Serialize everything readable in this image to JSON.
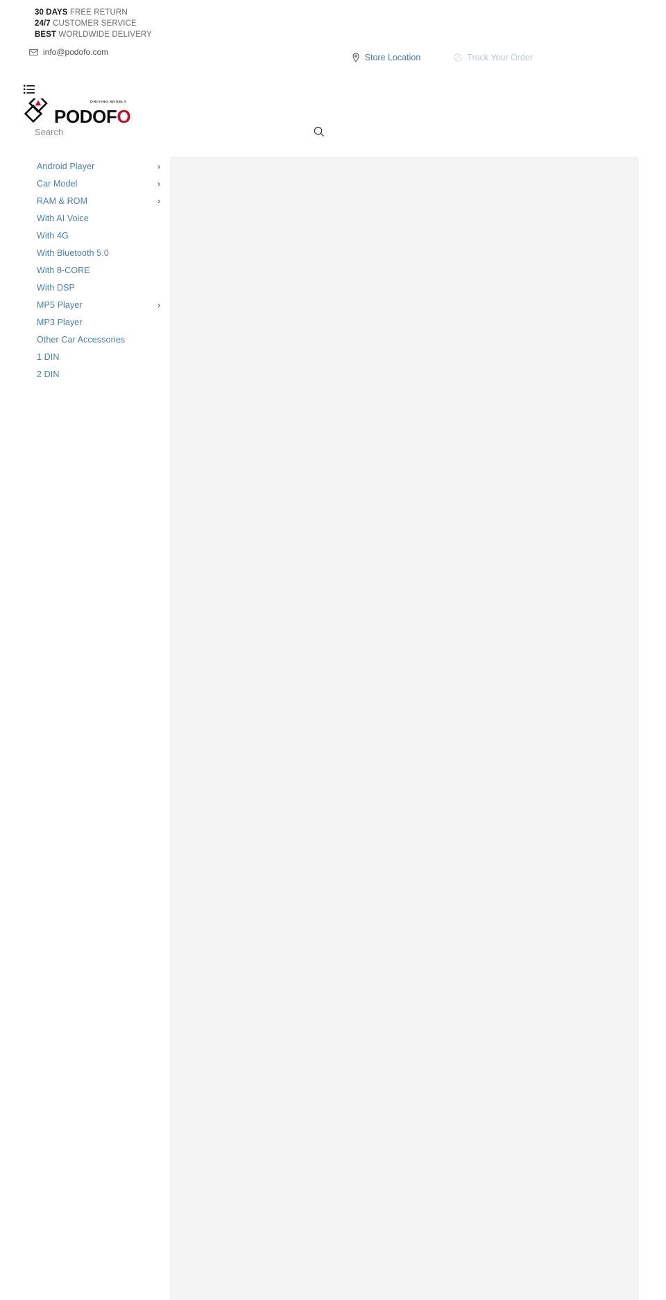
{
  "promo": {
    "lines": [
      {
        "strong": "30 DAYS",
        "rest": " FREE RETURN"
      },
      {
        "strong": "24/7",
        "rest": " CUSTOMER SERVICE"
      },
      {
        "strong": "BEST",
        "rest": "  WORLDWIDE DELIVERY"
      }
    ],
    "line1_strong": "30 DAYS",
    "line1_rest": " FREE RETURN",
    "line2_strong": "24/7",
    "line2_rest": " CUSTOMER SERVICE",
    "line3_strong": "BEST",
    "line3_rest": "  WORLDWIDE DELIVERY"
  },
  "contact": {
    "email": "info@podofo.com",
    "email_icon": "envelope-icon"
  },
  "utility": {
    "store_location": "Store Location",
    "store_location_icon": "map-pin-icon",
    "track_order": "Track Your Order",
    "track_order_icon": "truck-icon"
  },
  "header": {
    "menu_icon": "list-menu-icon",
    "logo_word_main": "PODOF",
    "logo_word_accent": "O",
    "logo_tagline": "DRIVING WISELY",
    "logo_accent_color": "#b5132b"
  },
  "search": {
    "placeholder": "Search",
    "value": "",
    "submit_icon": "search-icon"
  },
  "sidebar": {
    "items": [
      {
        "label": "Android Player",
        "expandable": true,
        "caret": "›"
      },
      {
        "label": "Car Model",
        "expandable": true,
        "caret": "›"
      },
      {
        "label": "RAM & ROM",
        "expandable": true,
        "caret": "›"
      },
      {
        "label": "With AI Voice",
        "expandable": false,
        "caret": ""
      },
      {
        "label": "With 4G",
        "expandable": false,
        "caret": ""
      },
      {
        "label": "With Bluetooth 5.0",
        "expandable": false,
        "caret": ""
      },
      {
        "label": "With 8-CORE",
        "expandable": false,
        "caret": ""
      },
      {
        "label": "With DSP",
        "expandable": false,
        "caret": ""
      },
      {
        "label": "MP5 Player",
        "expandable": true,
        "caret": "›"
      },
      {
        "label": "MP3 Player",
        "expandable": false,
        "caret": ""
      },
      {
        "label": "Other Car Accessories",
        "expandable": false,
        "caret": ""
      },
      {
        "label": "1 DIN",
        "expandable": false,
        "caret": ""
      },
      {
        "label": "2 DIN",
        "expandable": false,
        "caret": ""
      }
    ]
  },
  "main": {
    "content": "",
    "background_color": "#f4f4f4"
  },
  "colors": {
    "link_blue": "#4a7fa5",
    "link_faded": "#b9cbd8",
    "panel_gray": "#f4f4f4",
    "text_dark": "#1c1c1c"
  }
}
